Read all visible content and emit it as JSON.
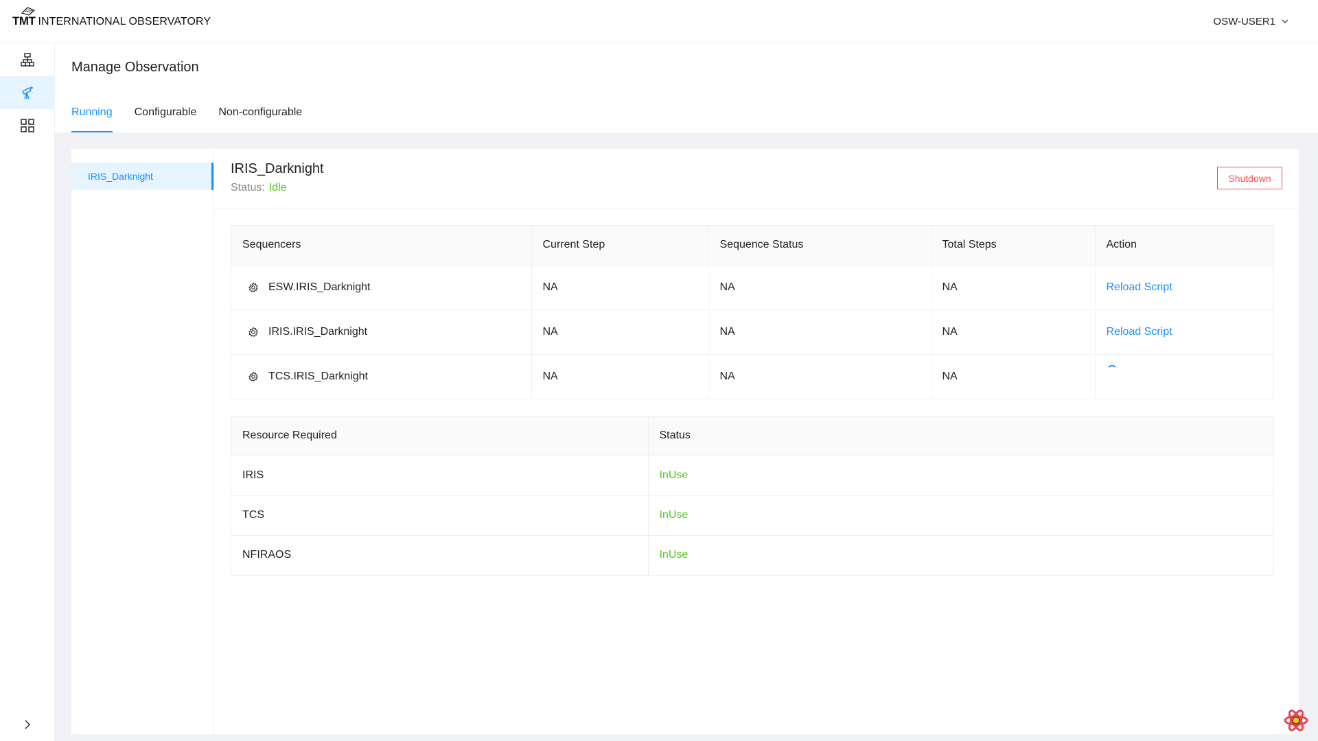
{
  "header": {
    "logo_tmt": "TMT",
    "logo_text": "INTERNATIONAL OBSERVATORY",
    "user": "OSW-USER1"
  },
  "sidebar": {
    "items": [
      {
        "icon": "hierarchy-icon",
        "active": false
      },
      {
        "icon": "telescope-icon",
        "active": true
      },
      {
        "icon": "grid-icon",
        "active": false
      }
    ],
    "collapse_icon": "chevron-right-icon"
  },
  "page": {
    "title": "Manage Observation",
    "tabs": [
      {
        "label": "Running",
        "active": true
      },
      {
        "label": "Configurable",
        "active": false
      },
      {
        "label": "Non-configurable",
        "active": false
      }
    ]
  },
  "observations": [
    {
      "label": "IRIS_Darknight",
      "selected": true
    }
  ],
  "detail": {
    "name": "IRIS_Darknight",
    "status_label": "Status:",
    "status_value": "Idle",
    "shutdown_label": "Shutdown"
  },
  "sequencers_table": {
    "headers": [
      "Sequencers",
      "Current Step",
      "Sequence Status",
      "Total Steps",
      "Action"
    ],
    "rows": [
      {
        "name": "ESW.IRIS_Darknight",
        "current_step": "NA",
        "status": "NA",
        "total": "NA",
        "action": "Reload Script"
      },
      {
        "name": "IRIS.IRIS_Darknight",
        "current_step": "NA",
        "status": "NA",
        "total": "NA",
        "action": "Reload Script"
      },
      {
        "name": "TCS.IRIS_Darknight",
        "current_step": "NA",
        "status": "NA",
        "total": "NA",
        "action": ""
      }
    ]
  },
  "resources_table": {
    "headers": [
      "Resource Required",
      "Status"
    ],
    "rows": [
      {
        "resource": "IRIS",
        "status": "InUse"
      },
      {
        "resource": "TCS",
        "status": "InUse"
      },
      {
        "resource": "NFIRAOS",
        "status": "InUse"
      }
    ]
  },
  "colors": {
    "primary": "#1890ff",
    "success": "#52c41a",
    "danger": "#ff4d4f"
  }
}
